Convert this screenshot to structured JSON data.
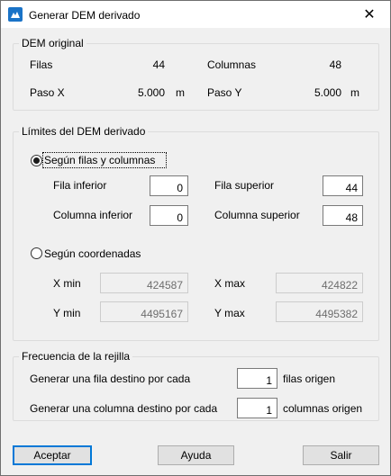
{
  "window": {
    "title": "Generar DEM derivado",
    "close_glyph": "✕",
    "app_icon": "dem-app-icon"
  },
  "dem_original": {
    "title": "DEM original",
    "filas_label": "Filas",
    "filas_value": "44",
    "columnas_label": "Columnas",
    "columnas_value": "48",
    "paso_x_label": "Paso X",
    "paso_x_value": "5.000",
    "paso_x_unit": "m",
    "paso_y_label": "Paso Y",
    "paso_y_value": "5.000",
    "paso_y_unit": "m"
  },
  "limites": {
    "title": "Límites del DEM derivado",
    "radio_filas_label": "Según filas y columnas",
    "fila_inferior_label": "Fila inferior",
    "fila_inferior_value": "0",
    "fila_superior_label": "Fila superior",
    "fila_superior_value": "44",
    "columna_inferior_label": "Columna inferior",
    "columna_inferior_value": "0",
    "columna_superior_label": "Columna superior",
    "columna_superior_value": "48",
    "radio_coord_label": "Según coordenadas",
    "xmin_label": "X min",
    "xmin_value": "424587",
    "xmax_label": "X max",
    "xmax_value": "424822",
    "ymin_label": "Y min",
    "ymin_value": "4495167",
    "ymax_label": "Y max",
    "ymax_value": "4495382"
  },
  "frecuencia": {
    "title": "Frecuencia de la rejilla",
    "fila_label": "Generar una fila destino por cada",
    "fila_value": "1",
    "fila_suffix": "filas origen",
    "columna_label": "Generar una columna destino por cada",
    "columna_value": "1",
    "columna_suffix": "columnas origen"
  },
  "buttons": {
    "aceptar": "Aceptar",
    "ayuda": "Ayuda",
    "salir": "Salir"
  },
  "colors": {
    "accent": "#0078d7",
    "background": "#f0f0f0"
  }
}
